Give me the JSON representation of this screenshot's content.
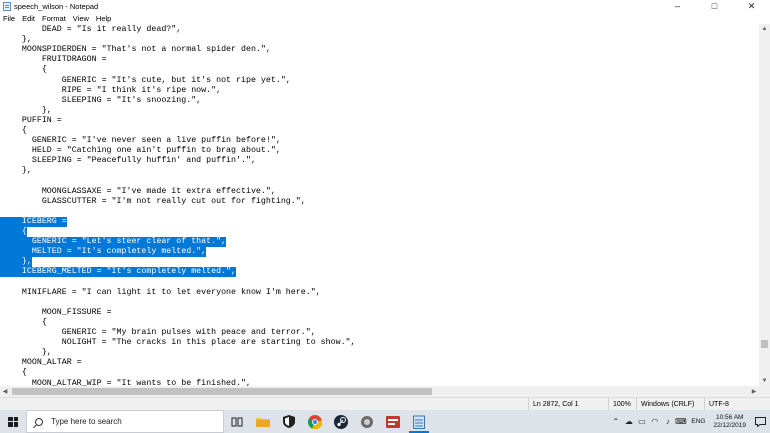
{
  "window": {
    "title": "speech_wilson - Notepad",
    "controls": [
      "–",
      "□",
      "✕"
    ]
  },
  "menu": [
    "File",
    "Edit",
    "Format",
    "View",
    "Help"
  ],
  "editor": {
    "lines": [
      {
        "text": "        DEAD = \"Is it really dead?\",",
        "selected": false
      },
      {
        "text": "    },",
        "selected": false
      },
      {
        "text": "    MOONSPIDERDEN = \"That's not a normal spider den.\",",
        "selected": false
      },
      {
        "text": "        FRUITDRAGON =",
        "selected": false
      },
      {
        "text": "        {",
        "selected": false
      },
      {
        "text": "            GENERIC = \"It's cute, but it's not ripe yet.\",",
        "selected": false
      },
      {
        "text": "            RIPE = \"I think it's ripe now.\",",
        "selected": false
      },
      {
        "text": "            SLEEPING = \"It's snoozing.\",",
        "selected": false
      },
      {
        "text": "        },",
        "selected": false
      },
      {
        "text": "    PUFFIN =",
        "selected": false
      },
      {
        "text": "    {",
        "selected": false
      },
      {
        "text": "      GENERIC = \"I've never seen a live puffin before!\",",
        "selected": false
      },
      {
        "text": "      HELD = \"Catching one ain't puffin to brag about.\",",
        "selected": false
      },
      {
        "text": "      SLEEPING = \"Peacefully huffin' and puffin'.\",",
        "selected": false
      },
      {
        "text": "    },",
        "selected": false
      },
      {
        "text": "",
        "selected": false
      },
      {
        "text": "        MOONGLASSAXE = \"I've made it extra effective.\",",
        "selected": false
      },
      {
        "text": "        GLASSCUTTER = \"I'm not really cut out for fighting.\",",
        "selected": false
      },
      {
        "text": "",
        "selected": false
      },
      {
        "text": "    ICEBERG =",
        "selected": true
      },
      {
        "text": "    {",
        "selected": true
      },
      {
        "text": "      GENERIC = \"Let's steer clear of that.\",",
        "selected": true
      },
      {
        "text": "      MELTED = \"It's completely melted.\",",
        "selected": true
      },
      {
        "text": "    },",
        "selected": true
      },
      {
        "text": "    ICEBERG_MELTED = \"It's completely melted.\",",
        "selected": true
      },
      {
        "text": "",
        "selected": false
      },
      {
        "text": "    MINIFLARE = \"I can light it to let everyone know I'm here.\",",
        "selected": false
      },
      {
        "text": "",
        "selected": false
      },
      {
        "text": "        MOON_FISSURE =",
        "selected": false
      },
      {
        "text": "        {",
        "selected": false
      },
      {
        "text": "            GENERIC = \"My brain pulses with peace and terror.\",",
        "selected": false
      },
      {
        "text": "            NOLIGHT = \"The cracks in this place are starting to show.\",",
        "selected": false
      },
      {
        "text": "        },",
        "selected": false
      },
      {
        "text": "    MOON_ALTAR =",
        "selected": false
      },
      {
        "text": "    {",
        "selected": false
      },
      {
        "text": "      MOON_ALTAR_WIP = \"It wants to be finished.\",",
        "selected": false
      }
    ]
  },
  "statusbar": {
    "position": "Ln 2872, Col 1",
    "zoom": "100%",
    "line_ending": "Windows (CRLF)",
    "encoding": "UTF-8"
  },
  "taskbar": {
    "search_placeholder": "Type here to search",
    "apps": [
      "task-view",
      "file-explorer",
      "security",
      "chrome",
      "steam",
      "app-circle",
      "app-red",
      "notepad"
    ],
    "tray_language": "ENG",
    "time": "10:56 AM",
    "date": "22/12/2019"
  },
  "colors": {
    "selection": "#0078d7",
    "taskbar": "#dde3e8",
    "statusbar": "#f0f0f0"
  }
}
